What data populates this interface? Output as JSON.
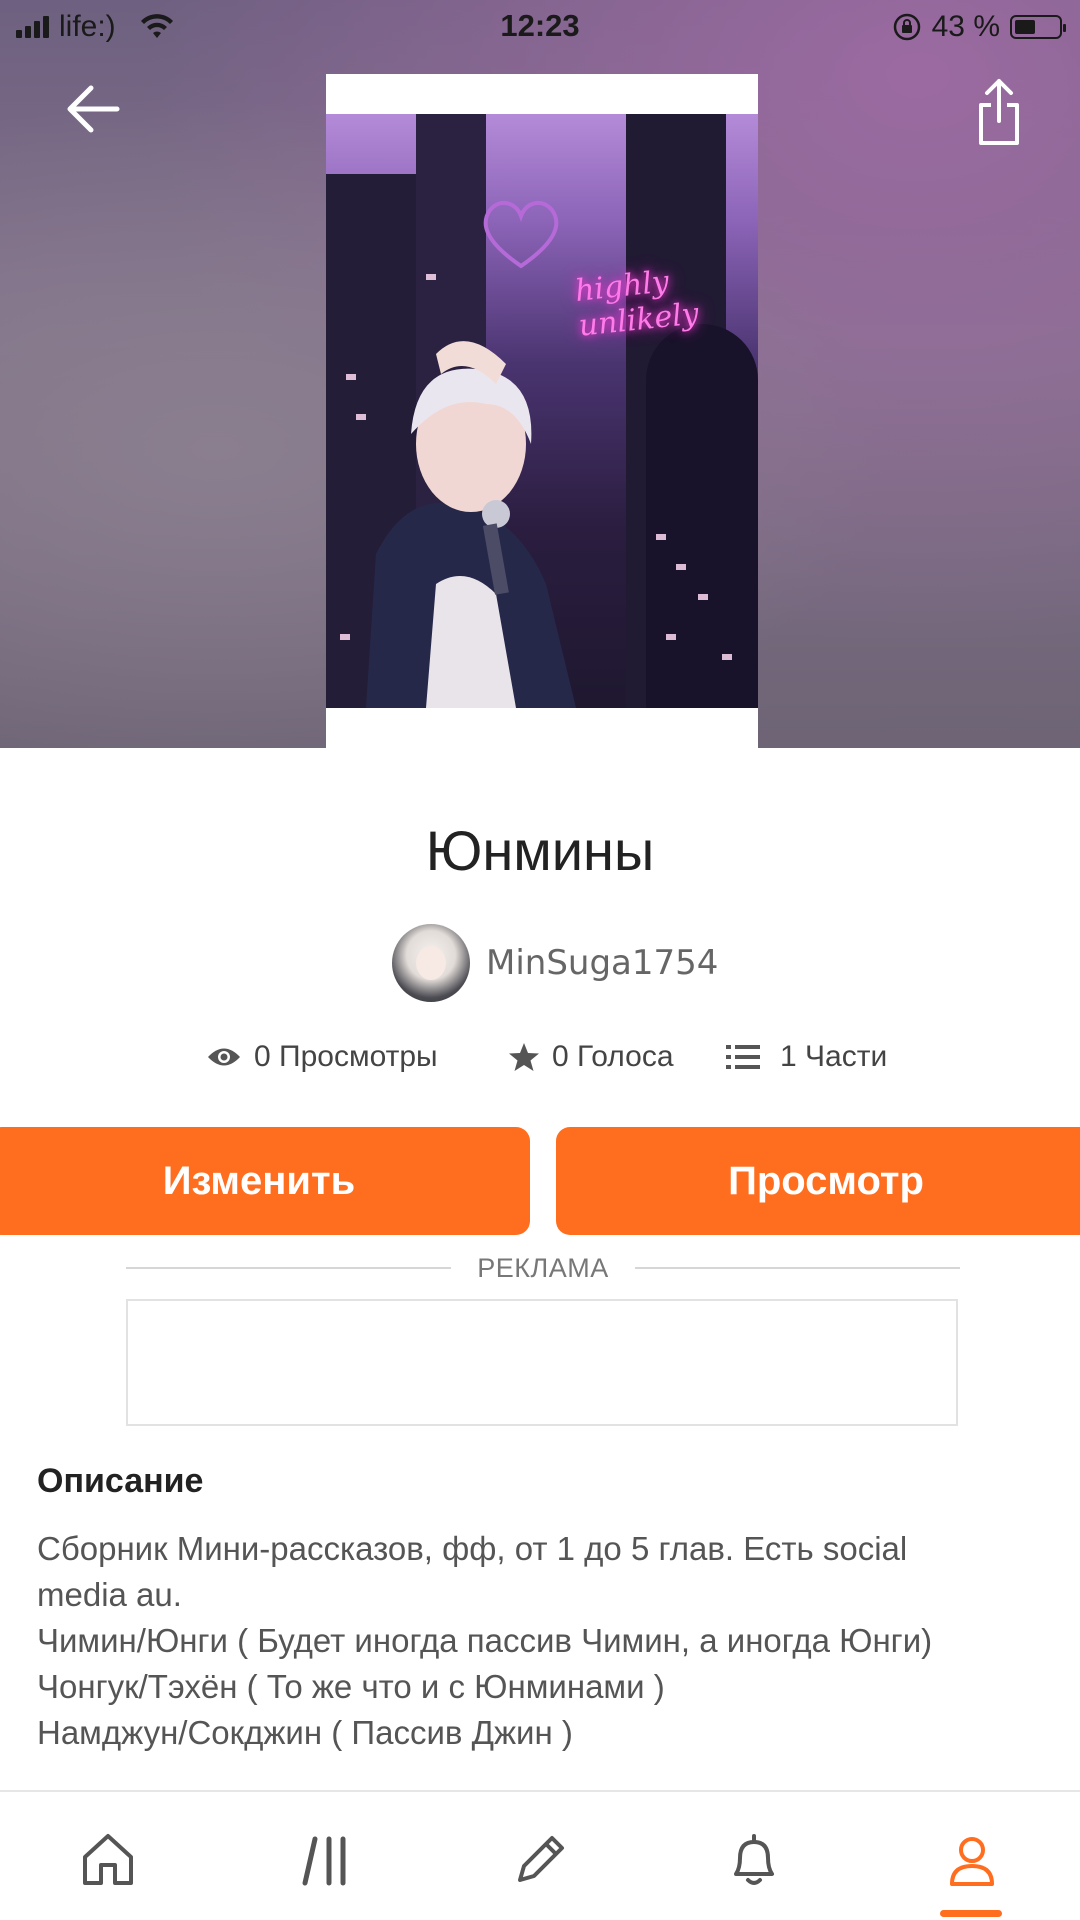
{
  "status_bar": {
    "carrier": "life:)",
    "time": "12:23",
    "battery_percent": "43 %"
  },
  "header": {
    "back_icon": "arrow-left-icon",
    "share_icon": "share-icon"
  },
  "story": {
    "cover_text": "highly unlikely",
    "title": "Юнмины",
    "author": "MinSuga1754"
  },
  "stats": {
    "views_num": "0",
    "views_label": "Просмотры",
    "votes_num": "0",
    "votes_label": "Голоса",
    "parts_num": "1",
    "parts_label": "Части"
  },
  "actions": {
    "edit_label": "Изменить",
    "view_label": "Просмотр"
  },
  "ad": {
    "label": "РЕКЛАМА"
  },
  "description": {
    "heading": "Описание",
    "lines": [
      "Сборник Мини-рассказов, фф, от 1 до 5 глав. Есть social",
      "media au.",
      "Чимин/Юнги ( Будет иногда пассив Чимин, а иногда Юнги)",
      "Чонгук/Тэхён ( То же что и с Юнминами )",
      "Намджун/Сокджин ( Пассив Джин )"
    ]
  },
  "bottom_nav": {
    "items": [
      "home-icon",
      "library-icon",
      "write-icon",
      "notifications-icon",
      "profile-icon"
    ],
    "active": "profile-icon"
  },
  "colors": {
    "accent": "#ff6e1f",
    "hero_purple": "#83728b"
  }
}
